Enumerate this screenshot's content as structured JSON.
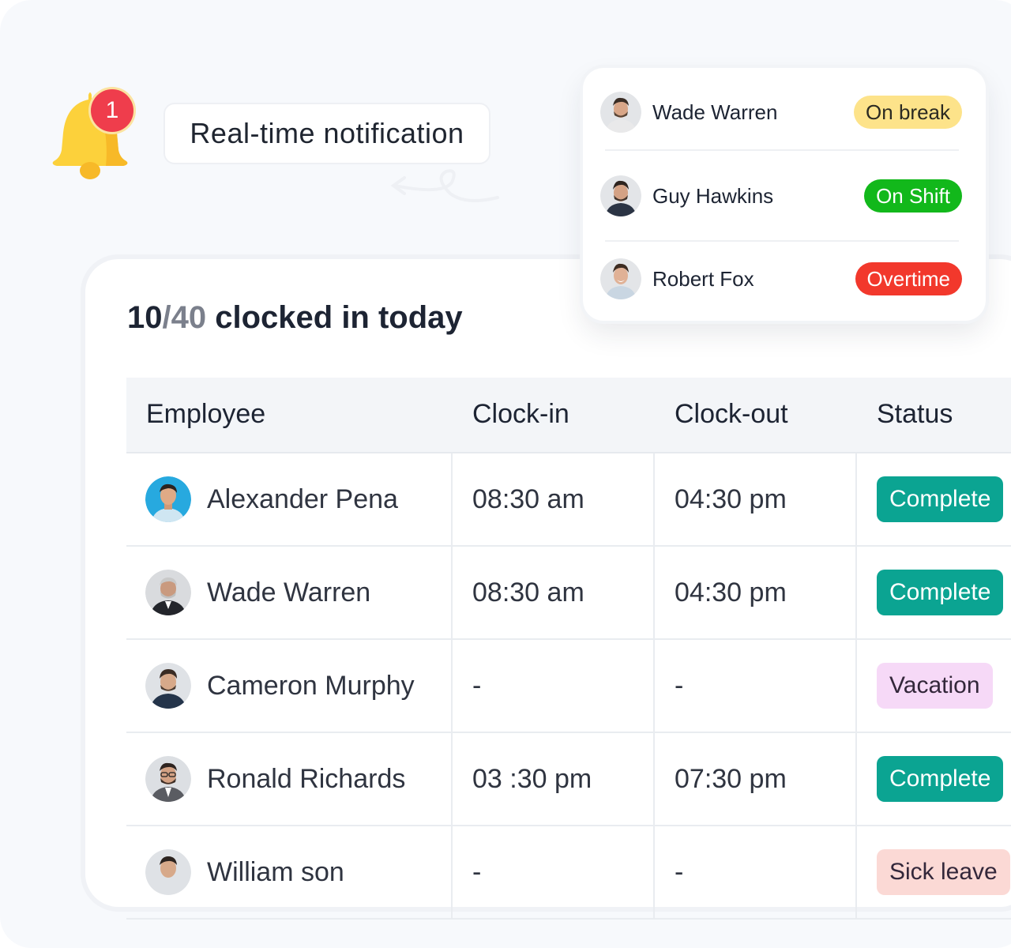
{
  "notification": {
    "badge_count": "1",
    "label": "Real-time notification"
  },
  "summary": {
    "clocked_in": "10",
    "separator": "/",
    "total": "40",
    "suffix": " clocked in today"
  },
  "status_popup": {
    "items": [
      {
        "name": "Wade Warren",
        "status": "On break",
        "color": "#fde38a"
      },
      {
        "name": "Guy Hawkins",
        "status": "On Shift",
        "color": "#12b81b"
      },
      {
        "name": "Robert Fox",
        "status": "Overtime",
        "color": "#f2382c"
      }
    ]
  },
  "table": {
    "headers": {
      "employee": "Employee",
      "clock_in": "Clock-in",
      "clock_out": "Clock-out",
      "status": "Status"
    },
    "rows": [
      {
        "name": "Alexander Pena",
        "clock_in": "08:30 am",
        "clock_out": "04:30 pm",
        "status": "Complete"
      },
      {
        "name": "Wade Warren",
        "clock_in": "08:30 am",
        "clock_out": "04:30 pm",
        "status": "Complete"
      },
      {
        "name": "Cameron Murphy",
        "clock_in": "-",
        "clock_out": "-",
        "status": "Vacation"
      },
      {
        "name": "Ronald Richards",
        "clock_in": "03 :30 pm",
        "clock_out": "07:30 pm",
        "status": "Complete"
      },
      {
        "name": "William son",
        "clock_in": "-",
        "clock_out": "-",
        "status": "Sick leave"
      }
    ]
  },
  "colors": {
    "complete": "#0ba492",
    "vacation": "#f6d9f7",
    "sick_leave": "#fbd9d5",
    "badge_red": "#ef3d4c",
    "bell_yellow": "#fcd13b"
  }
}
